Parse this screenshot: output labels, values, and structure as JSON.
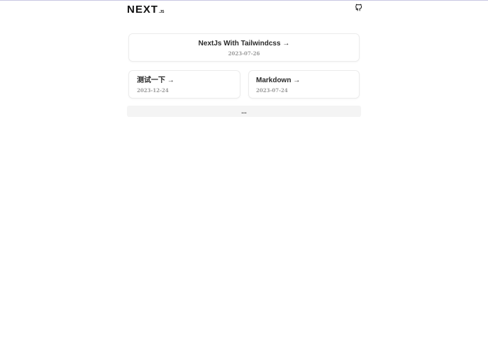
{
  "header": {
    "logo_main": "NEXT",
    "logo_suffix": ".JS",
    "github_icon": "github-icon"
  },
  "posts": [
    {
      "title": "NextJs With Tailwindcss",
      "arrow": "→",
      "date": "2023-07-26"
    },
    {
      "title": "测试一下",
      "arrow": "→",
      "date": "2023-12-24"
    },
    {
      "title": "Markdown",
      "arrow": "→",
      "date": "2023-07-24"
    }
  ],
  "more_label": "...",
  "colors": {
    "card_border": "#ececec",
    "date_text": "#9a9a9a",
    "more_bg": "#f4f4f4",
    "top_line": "#c9c7e3"
  }
}
